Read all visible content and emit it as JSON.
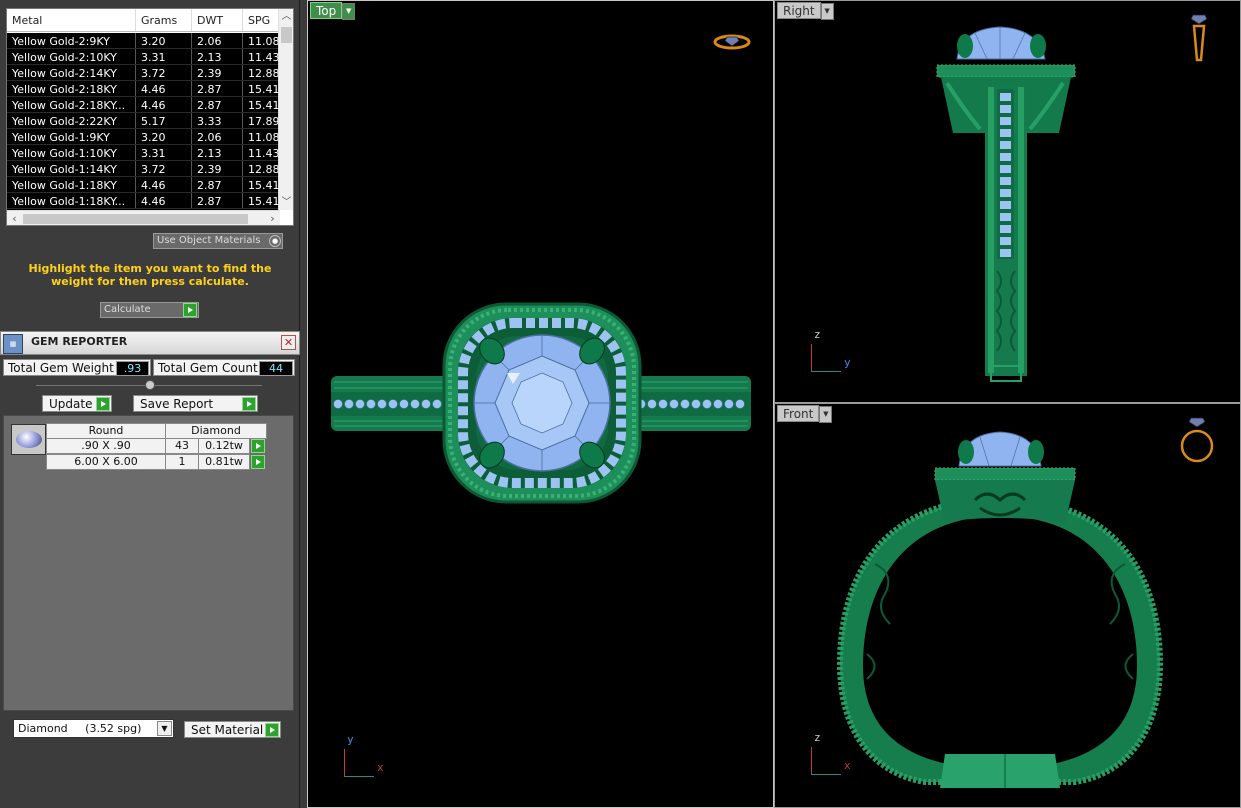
{
  "metal_table": {
    "headers": [
      "Metal",
      "Grams",
      "DWT",
      "SPG"
    ],
    "rows": [
      [
        "Yellow Gold-2:9KY",
        "3.20",
        "2.06",
        "11.08"
      ],
      [
        "Yellow Gold-2:10KY",
        "3.31",
        "2.13",
        "11.43"
      ],
      [
        "Yellow Gold-2:14KY",
        "3.72",
        "2.39",
        "12.88"
      ],
      [
        "Yellow Gold-2:18KY",
        "4.46",
        "2.87",
        "15.41"
      ],
      [
        "Yellow Gold-2:18KY...",
        "4.46",
        "2.87",
        "15.41"
      ],
      [
        "Yellow Gold-2:22KY",
        "5.17",
        "3.33",
        "17.89"
      ],
      [
        "Yellow Gold-1:9KY",
        "3.20",
        "2.06",
        "11.08"
      ],
      [
        "Yellow Gold-1:10KY",
        "3.31",
        "2.13",
        "11.43"
      ],
      [
        "Yellow Gold-1:14KY",
        "3.72",
        "2.39",
        "12.88"
      ],
      [
        "Yellow Gold-1:18KY",
        "4.46",
        "2.87",
        "15.41"
      ],
      [
        "Yellow Gold-1:18KY...",
        "4.46",
        "2.87",
        "15.41"
      ]
    ]
  },
  "use_object_materials": "Use Object Materials",
  "hint": "Highlight the item you want to find the weight for then press calculate.",
  "calculate": "Calculate",
  "gem_reporter": {
    "title": "GEM REPORTER",
    "total_weight_label": "Total Gem Weight",
    "total_weight": ".93",
    "total_count_label": "Total Gem Count",
    "total_count": "44",
    "update": "Update",
    "save_report": "Save Report",
    "col_shape": "Round",
    "col_type": "Diamond",
    "rows": [
      {
        "size": ".90 X .90",
        "count": "43",
        "weight": "0.12tw"
      },
      {
        "size": "6.00 X 6.00",
        "count": "1",
        "weight": "0.81tw"
      }
    ]
  },
  "material_select": "Diamond     (3.52 spg)",
  "set_material": "Set Material",
  "viewports": {
    "top": {
      "label": "Top",
      "axis_v": "y",
      "axis_h": "x"
    },
    "right": {
      "label": "Right",
      "axis_v": "z",
      "axis_h": "y"
    },
    "front": {
      "label": "Front",
      "axis_v": "z",
      "axis_h": "x"
    }
  },
  "colors": {
    "metal_green": "#1f8a5c",
    "gem_blue": "#8fb4ef",
    "axis_red": "#c13b3b",
    "axis_teal": "#2a8a8a",
    "hint_yellow": "#ffd21a"
  }
}
